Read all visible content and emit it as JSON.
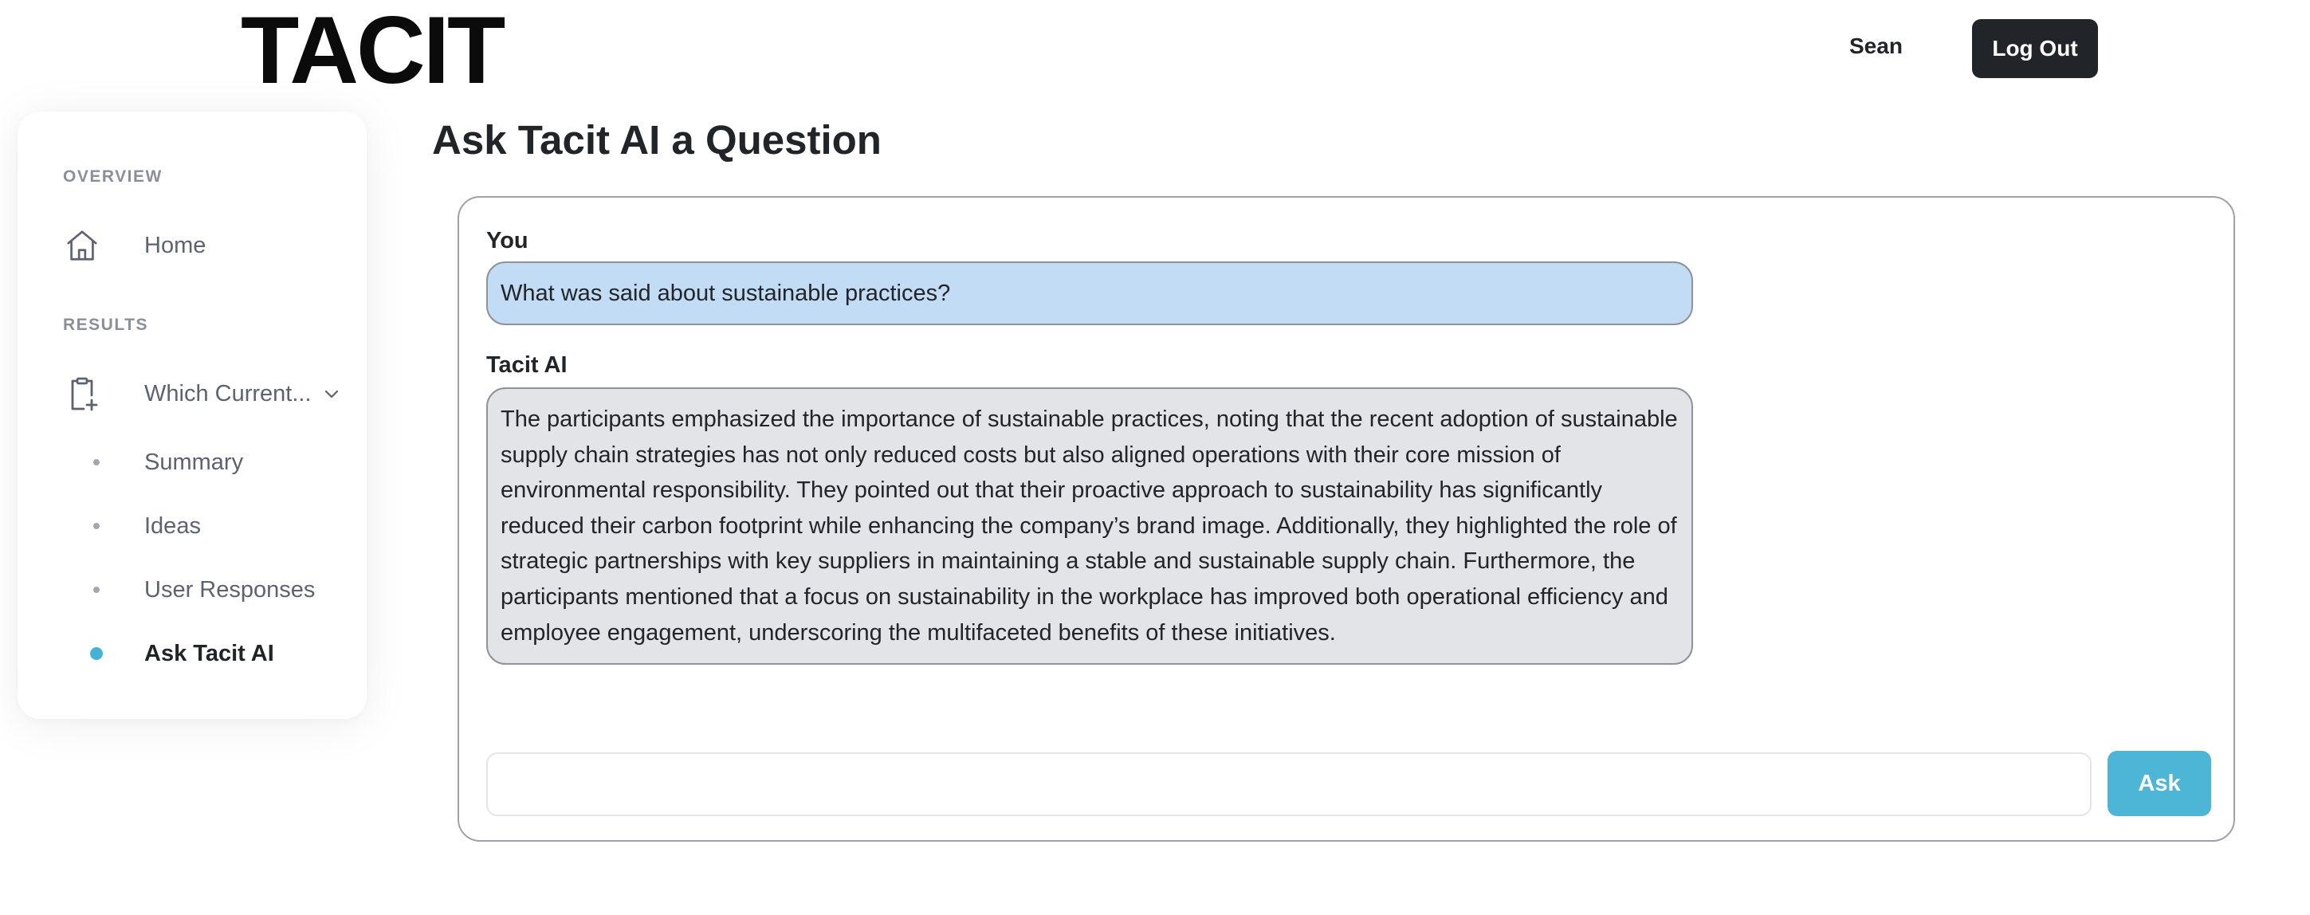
{
  "header": {
    "logo": "TACIT",
    "user_name": "Sean",
    "logout_label": "Log Out"
  },
  "sidebar": {
    "overview_heading": "OVERVIEW",
    "home_label": "Home",
    "results_heading": "RESULTS",
    "survey_label": "Which Current...",
    "sub_items": [
      {
        "label": "Summary",
        "active": false
      },
      {
        "label": "Ideas",
        "active": false
      },
      {
        "label": "User Responses",
        "active": false
      },
      {
        "label": "Ask Tacit AI",
        "active": true
      }
    ]
  },
  "main": {
    "title": "Ask Tacit AI a Question",
    "messages": [
      {
        "speaker": "You",
        "text": "What was said about sustainable practices?"
      },
      {
        "speaker": "Tacit AI",
        "text": "The participants emphasized the importance of sustainable practices, noting that the recent adoption of sustainable supply chain strategies has not only reduced costs but also aligned operations with their core mission of environmental responsibility. They pointed out that their proactive approach to sustainability has significantly reduced their carbon footprint while enhancing the company’s brand image. Additionally, they highlighted the role of strategic partnerships with key suppliers in maintaining a stable and sustainable supply chain. Furthermore, the participants mentioned that a focus on sustainability in the workplace has improved both operational efficiency and employee engagement, underscoring the multifaceted benefits of these initiatives."
      }
    ],
    "input_value": "",
    "input_placeholder": "",
    "ask_label": "Ask"
  },
  "colors": {
    "accent": "#45b4d3",
    "dark": "#212529",
    "user_bubble": "#c2dcf5",
    "ai_bubble": "#e2e4e8"
  },
  "icons": {
    "home": "home-icon",
    "survey": "clipboard-plus-icon",
    "expand": "chevron-down-icon"
  }
}
